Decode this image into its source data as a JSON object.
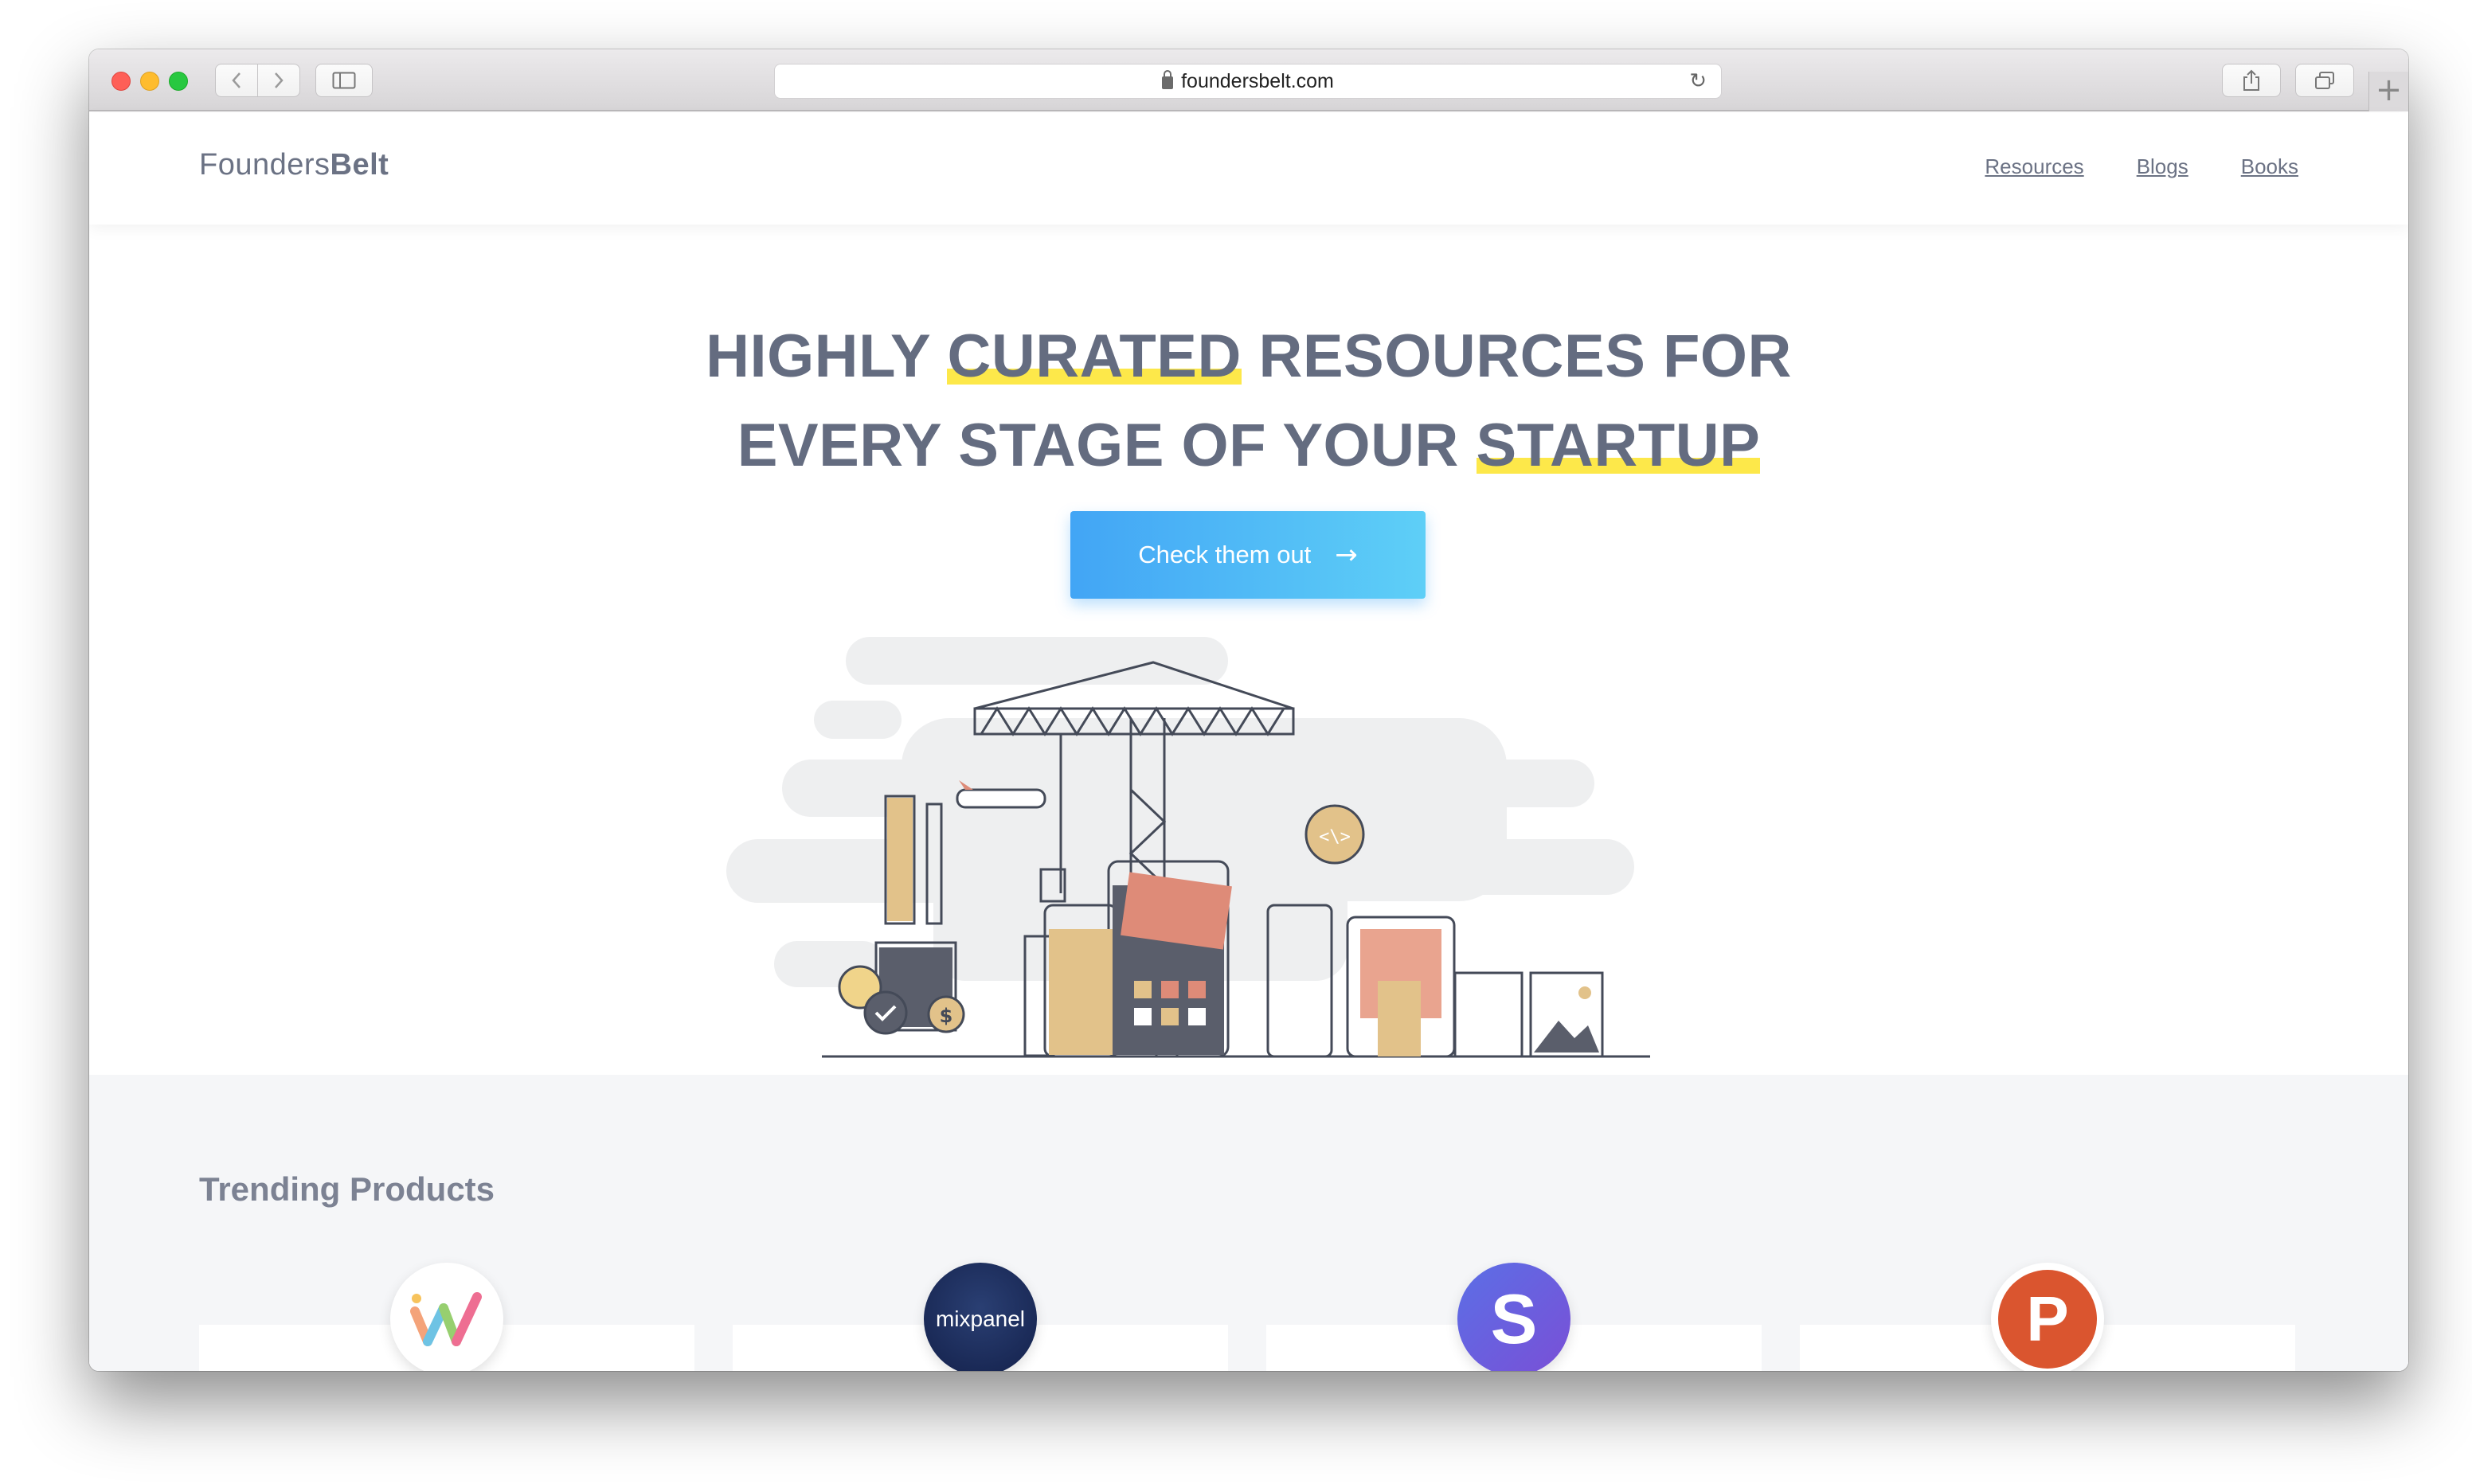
{
  "browser": {
    "url": "foundersbelt.com"
  },
  "header": {
    "brand_regular": "Founders",
    "brand_bold": "Belt",
    "nav": [
      {
        "label": "Resources"
      },
      {
        "label": "Blogs"
      },
      {
        "label": "Books"
      }
    ]
  },
  "hero": {
    "line1_pre": "HIGHLY ",
    "line1_highlight": "CURATED",
    "line1_post": " RESOURCES FOR",
    "line2_pre": "EVERY STAGE OF YOUR ",
    "line2_highlight": "STARTUP",
    "cta_label": "Check them out",
    "cta_arrow": "→"
  },
  "trending": {
    "title": "Trending Products",
    "products": [
      {
        "logo": "w-logo-icon"
      },
      {
        "logo_text": "mixpanel"
      },
      {
        "logo_text": "S"
      },
      {
        "logo_text": "P"
      }
    ]
  },
  "colors": {
    "brand_text": "#6b7284",
    "highlight": "#fde84a",
    "cta_start": "#42a5f5",
    "cta_end": "#5ecff7"
  }
}
